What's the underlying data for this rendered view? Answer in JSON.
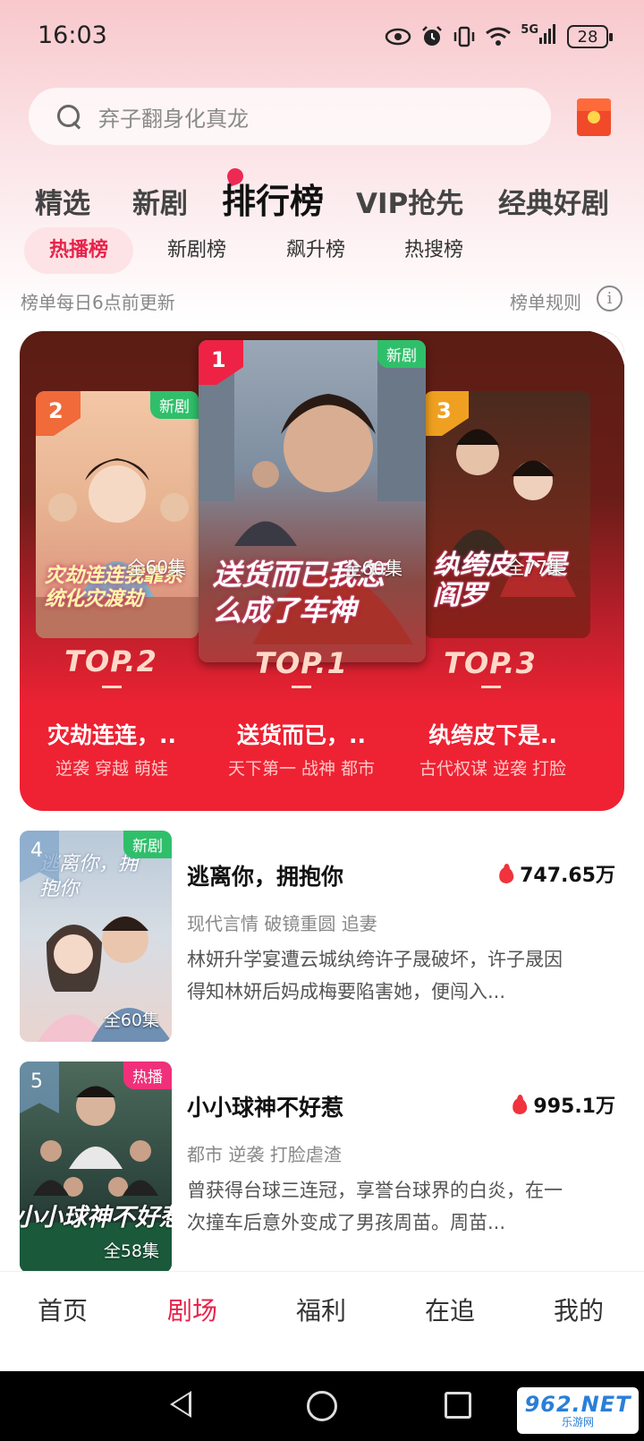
{
  "status_bar": {
    "time": "16:03",
    "network": "5G",
    "battery": "28"
  },
  "search": {
    "placeholder": "弃子翻身化真龙"
  },
  "main_tabs": [
    {
      "label": "精选",
      "active": false
    },
    {
      "label": "新剧",
      "active": false
    },
    {
      "label": "排行榜",
      "active": true
    },
    {
      "label": "VIP抢先",
      "active": false
    },
    {
      "label": "经典好剧",
      "active": false
    }
  ],
  "sub_tabs": [
    {
      "label": "热播榜",
      "active": true
    },
    {
      "label": "新剧榜",
      "active": false
    },
    {
      "label": "飙升榜",
      "active": false
    },
    {
      "label": "热搜榜",
      "active": false
    }
  ],
  "ranking": {
    "update_note": "榜单每日6点前更新",
    "rules_label": "榜单规则",
    "info_glyph": "i"
  },
  "top3": [
    {
      "rank": "2",
      "tag": "新剧",
      "episodes": "全60集",
      "top_label": "TOP.2",
      "poster_art": "灾劫连连我靠系统化灾渡劫",
      "title": "灾劫连连，..",
      "genres": "逆袭 穿越 萌娃",
      "colors": {
        "top": "#f3c7a6",
        "bottom": "#d88a78"
      }
    },
    {
      "rank": "1",
      "tag": "新剧",
      "episodes": "全60集",
      "top_label": "TOP.1",
      "poster_art": "送货而已我怎么成了车神",
      "title": "送货而已，..",
      "genres": "天下第一 战神 都市",
      "colors": {
        "top": "#7e8ea0",
        "bottom": "#b03a3a"
      }
    },
    {
      "rank": "3",
      "tag": "",
      "episodes": "全77集",
      "top_label": "TOP.3",
      "poster_art": "纨绔皮下是阎罗",
      "title": "纨绔皮下是..",
      "genres": "古代权谋 逆袭 打脸",
      "colors": {
        "top": "#4a2a1e",
        "bottom": "#8c1e1a"
      }
    }
  ],
  "list": [
    {
      "rank": "4",
      "tag": "新剧",
      "tag_color": "#2fbf6a",
      "episodes": "全60集",
      "poster_art": "逃离你，拥抱你",
      "title": "逃离你，拥抱你",
      "heat": "747.65万",
      "genres": "现代言情 破镜重圆 追妻",
      "desc": "林妍升学宴遭云城纨绔许子晟破坏，许子晟因得知林妍后妈成梅要陷害她，便闯入...",
      "colors": {
        "top": "#b9c9d8",
        "bottom": "#e9d4cf"
      }
    },
    {
      "rank": "5",
      "tag": "热播",
      "tag_color": "#f0307a",
      "episodes": "全58集",
      "poster_art": "小小球神不好惹",
      "title": "小小球神不好惹",
      "heat": "995.1万",
      "genres": "都市 逆袭 打脸虐渣",
      "desc": "曾获得台球三连冠，享誉台球界的白炎，在一次撞车后意外变成了男孩周苗。周苗...",
      "colors": {
        "top": "#4d6a5c",
        "bottom": "#1e2d2a"
      }
    }
  ],
  "bottom_nav": [
    {
      "label": "首页",
      "active": false
    },
    {
      "label": "剧场",
      "active": true
    },
    {
      "label": "福利",
      "active": false
    },
    {
      "label": "在追",
      "active": false
    },
    {
      "label": "我的",
      "active": false
    }
  ],
  "watermark": {
    "main": "962.NET",
    "sub": "乐游网"
  },
  "colors": {
    "accent": "#e8234a",
    "panel_dark": "#5a1d14",
    "panel_red": "#ef2233",
    "new_tag": "#2fbf6a",
    "rank1": "#ee2244",
    "rank2": "#f06a3a",
    "rank3": "#f0a020"
  }
}
